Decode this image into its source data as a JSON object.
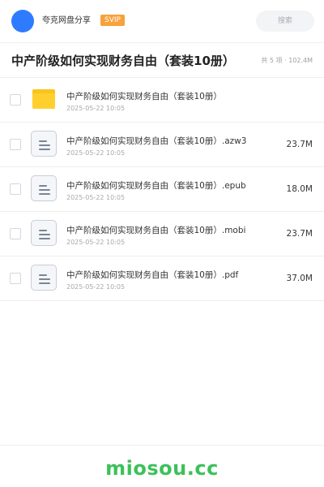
{
  "header": {
    "brand": "夸克网盘分享",
    "badge": "SVIP",
    "search_label": "搜索",
    "avatar_color": "#2f7bff",
    "badge_color": "#f7a23b"
  },
  "folder": {
    "title": "中产阶级如何实现财务自由（套装10册）",
    "meta": "共 5 项 · 102.4M"
  },
  "files": [
    {
      "type": "folder-icon",
      "name": "中产阶级如何实现财务自由（套装10册）",
      "date": "2025-05-22 10:05",
      "size": ""
    },
    {
      "type": "document-icon",
      "name": "中产阶级如何实现财务自由（套装10册）.azw3",
      "date": "2025-05-22 10:05",
      "size": "23.7M"
    },
    {
      "type": "document-icon",
      "name": "中产阶级如何实现财务自由（套装10册）.epub",
      "date": "2025-05-22 10:05",
      "size": "18.0M"
    },
    {
      "type": "document-icon",
      "name": "中产阶级如何实现财务自由（套装10册）.mobi",
      "date": "2025-05-22 10:05",
      "size": "23.7M"
    },
    {
      "type": "document-icon",
      "name": "中产阶级如何实现财务自由（套装10册）.pdf",
      "date": "2025-05-22 10:05",
      "size": "37.0M"
    }
  ],
  "footer": {
    "watermark": "miosou.cc",
    "watermark_color": "#3cc15a"
  }
}
